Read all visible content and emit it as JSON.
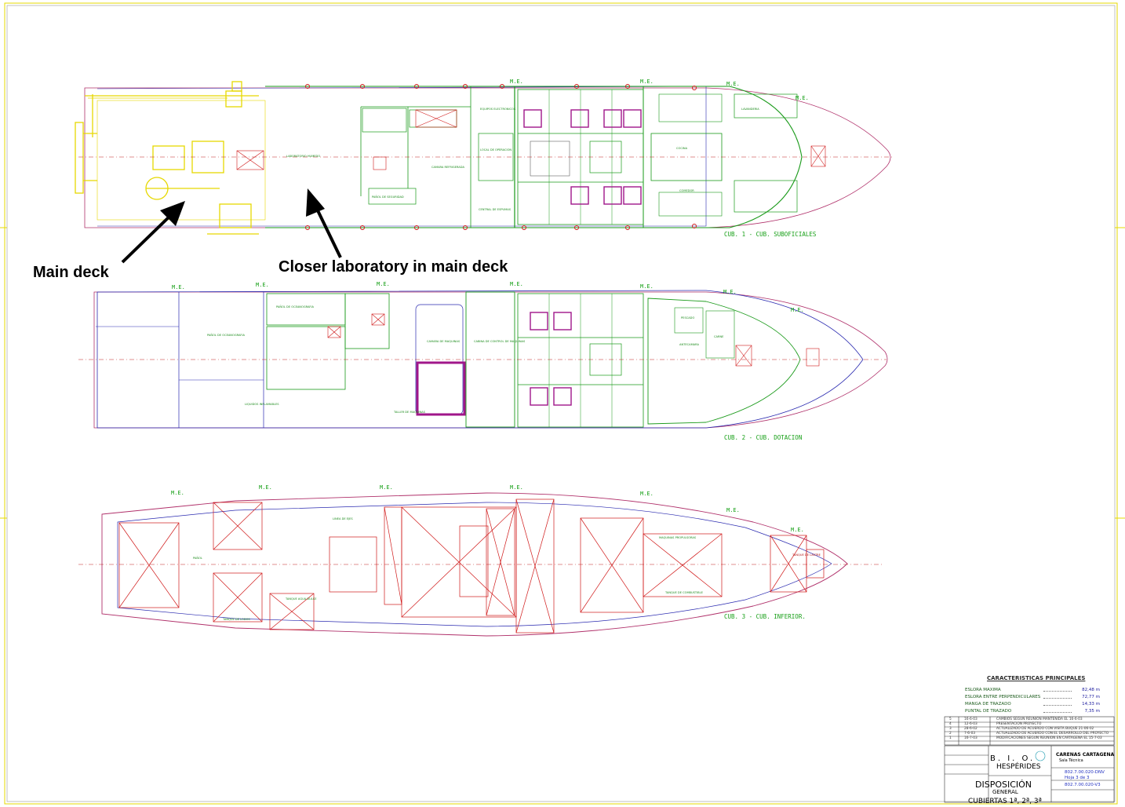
{
  "annotations": {
    "main_deck": "Main deck",
    "closer_lab": "Closer laboratory in main deck"
  },
  "decks": [
    {
      "caption": "CUB. 1 - CUB. SUBOFICIALES"
    },
    {
      "caption": "CUB. 2 - CUB. DOTACION"
    },
    {
      "caption": "CUB. 3 - CUB. INFERIOR."
    }
  ],
  "me_label": "M.E.",
  "room_labels": {
    "deck1": [
      "LABORATORIO HUMEDO",
      "LOCAL DE OPERACION",
      "CENTRAL DE ESPUMAS",
      "LAVANDERIA",
      "COCINA",
      "COMEDOR",
      "PAÑOL DE SEGURIDAD",
      "CAMARA REFRIGERADA",
      "EQUIPOS ELECTRONICOS"
    ],
    "deck2": [
      "PAÑOL DE OCEANOGRAFIA",
      "CAMARA DE MAQUINAS",
      "CABINA DE CONTROL DE MAQUINAS",
      "PAÑOL DE OCEANOGRAFIA",
      "LIQUIDOS INFLAMABLES",
      "TALLER DE MAQUINAS",
      "PESCADO",
      "CARNE",
      "ANTECAMARA"
    ],
    "deck3": [
      "PAÑOL",
      "LINEA DE EJES",
      "TANQUE DE LASTRE",
      "TANQUE AGUA DULCE",
      "TANQUE DE LODOS",
      "MAQUINAS PROPULSORAS",
      "TANQUE DE COMBUSTIBLE"
    ]
  },
  "title_block": {
    "heading": "CARACTERISTICAS PRINCIPALES",
    "specs": [
      {
        "label": "ESLORA MAXIMA",
        "value": "82,48 m"
      },
      {
        "label": "ESLORA ENTRE PERPENDICULARES",
        "value": "72,77 m"
      },
      {
        "label": "MANGA DE TRAZADO",
        "value": "14,33 m"
      },
      {
        "label": "PUNTAL DE TRAZADO",
        "value": "7,35 m"
      }
    ],
    "revisions": [
      {
        "num": "5",
        "date": "16-6-03",
        "text": "CAMBIOS SEGUN REUNION MANTENIDA EL 16-6-03"
      },
      {
        "num": "4",
        "date": "12-6-03",
        "text": "PRESENTACION PROYECTO"
      },
      {
        "num": "3",
        "date": "28-6-02",
        "text": "ACTUALIZADO DE ACUERDO CON VISITA BUQUE 21-06-02"
      },
      {
        "num": "2",
        "date": "7-6-03",
        "text": "ACTUALIZADO DE ACUERDO CON EL DESARROLLO DEL PROYECTO"
      },
      {
        "num": "1",
        "date": "16-7-03",
        "text": "MODIFICACIONES SEGUN REUNION EN CARTAGENA EL 15-7-03"
      }
    ],
    "organization": "CARENAS CARTAGENA",
    "organization_sub": "Sala Técnica",
    "ship_line1": "B. I. O.",
    "ship_line2": "HESPÉRIDES",
    "plano": "802.7.00.020-DNV",
    "hoja": "Hoja 3 de 3",
    "sustituye": "802.7.00.020-V3",
    "title1": "DISPOSICIÓN",
    "title2": "GENERAL",
    "title3": "CUBIERTAS 1ª, 2ª, 3ª"
  },
  "colors": {
    "hull_outline": "#b0306a",
    "deck_structure": "#1a9a1a",
    "ghost_outline": "#2a2ab0",
    "main_deck_equipment": "#e6d800",
    "tanks": "#d01818",
    "centerline": "#c02020",
    "annotation": "#000000"
  }
}
